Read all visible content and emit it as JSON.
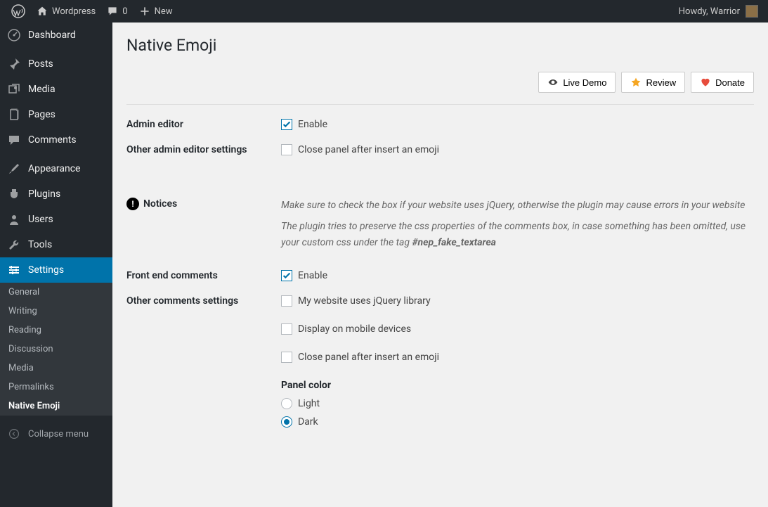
{
  "toolbar": {
    "site_name": "Wordpress",
    "comments_count": "0",
    "new_label": "New",
    "howdy": "Howdy, Warrior"
  },
  "sidebar": {
    "items": [
      {
        "label": "Dashboard",
        "icon": "dashboard"
      },
      {
        "label": "Posts",
        "icon": "posts"
      },
      {
        "label": "Media",
        "icon": "media"
      },
      {
        "label": "Pages",
        "icon": "pages"
      },
      {
        "label": "Comments",
        "icon": "comments"
      },
      {
        "label": "Appearance",
        "icon": "appearance"
      },
      {
        "label": "Plugins",
        "icon": "plugins"
      },
      {
        "label": "Users",
        "icon": "users"
      },
      {
        "label": "Tools",
        "icon": "tools"
      },
      {
        "label": "Settings",
        "icon": "settings"
      }
    ],
    "submenu": [
      {
        "label": "General"
      },
      {
        "label": "Writing"
      },
      {
        "label": "Reading"
      },
      {
        "label": "Discussion"
      },
      {
        "label": "Media"
      },
      {
        "label": "Permalinks"
      },
      {
        "label": "Native Emoji"
      }
    ],
    "collapse": "Collapse menu"
  },
  "page": {
    "title": "Native Emoji",
    "actions": {
      "live_demo": "Live Demo",
      "review": "Review",
      "donate": "Donate"
    },
    "sections": {
      "admin_editor": {
        "label": "Admin editor",
        "enable": "Enable"
      },
      "other_admin": {
        "label": "Other admin editor settings",
        "close_panel": "Close panel after insert an emoji"
      },
      "notices": {
        "label": "Notices",
        "line1": "Make sure to check the box if your website uses jQuery, otherwise the plugin may cause errors in your website",
        "line2_a": "The plugin tries to preserve the css properties of the comments box, in case something has been omitted, use your custom css under the tag ",
        "line2_b": "#nep_fake_textarea"
      },
      "front_comments": {
        "label": "Front end comments",
        "enable": "Enable"
      },
      "other_comments": {
        "label": "Other comments settings",
        "jquery": "My website uses jQuery library",
        "mobile": "Display on mobile devices",
        "close_panel": "Close panel after insert an emoji",
        "panel_color_label": "Panel color",
        "light": "Light",
        "dark": "Dark"
      }
    }
  }
}
